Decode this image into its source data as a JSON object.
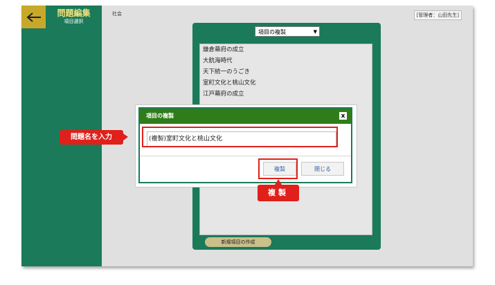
{
  "header": {
    "back_icon": "arrow-left-icon",
    "title": "問題編集",
    "subtitle": "項目選択"
  },
  "subject": "社会",
  "user_badge": "[管理者：山田先生]",
  "panel": {
    "select_value": "項目の複製",
    "items": [
      "鎌倉幕府の成立",
      "大航海時代",
      "天下統一のうごき",
      "室町文化と桃山文化",
      "江戸幕府の成立"
    ],
    "new_item_button": "新規項目の作成"
  },
  "dialog": {
    "title": "項目の複製",
    "close_icon": "x",
    "input_value": "(複製)室町文化と桃山文化",
    "copy_button": "複製",
    "close_button": "閉じる"
  },
  "callouts": {
    "input_label": "問題名を入力",
    "copy_label": "複製"
  },
  "colors": {
    "sidebar": "#1a7a5a",
    "back_button": "#c8a82a",
    "dialog_header": "#2e7d1a",
    "highlight": "#e0201a"
  }
}
